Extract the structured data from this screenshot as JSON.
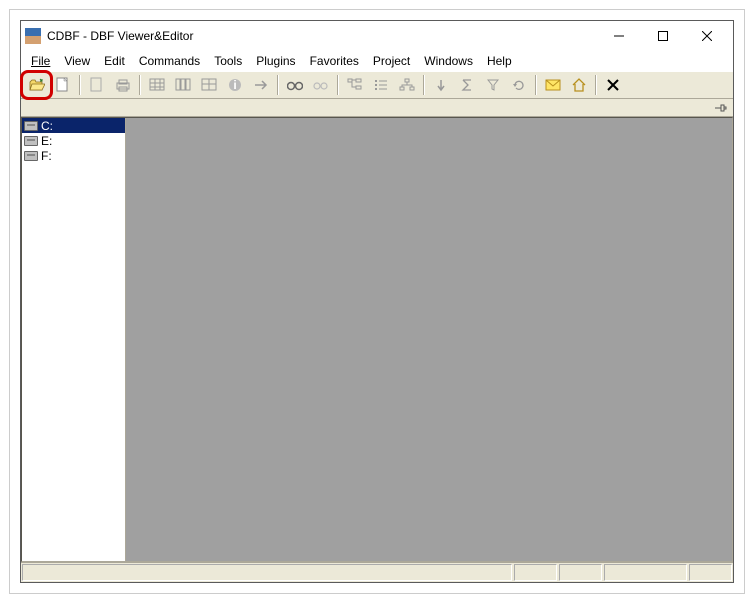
{
  "window": {
    "title": "CDBF - DBF Viewer&Editor"
  },
  "menu": {
    "file": "File",
    "view": "View",
    "edit": "Edit",
    "commands": "Commands",
    "tools": "Tools",
    "plugins": "Plugins",
    "favorites": "Favorites",
    "project": "Project",
    "windows": "Windows",
    "help": "Help"
  },
  "drives": [
    {
      "label": "C:"
    },
    {
      "label": "E:"
    },
    {
      "label": "F:"
    }
  ]
}
